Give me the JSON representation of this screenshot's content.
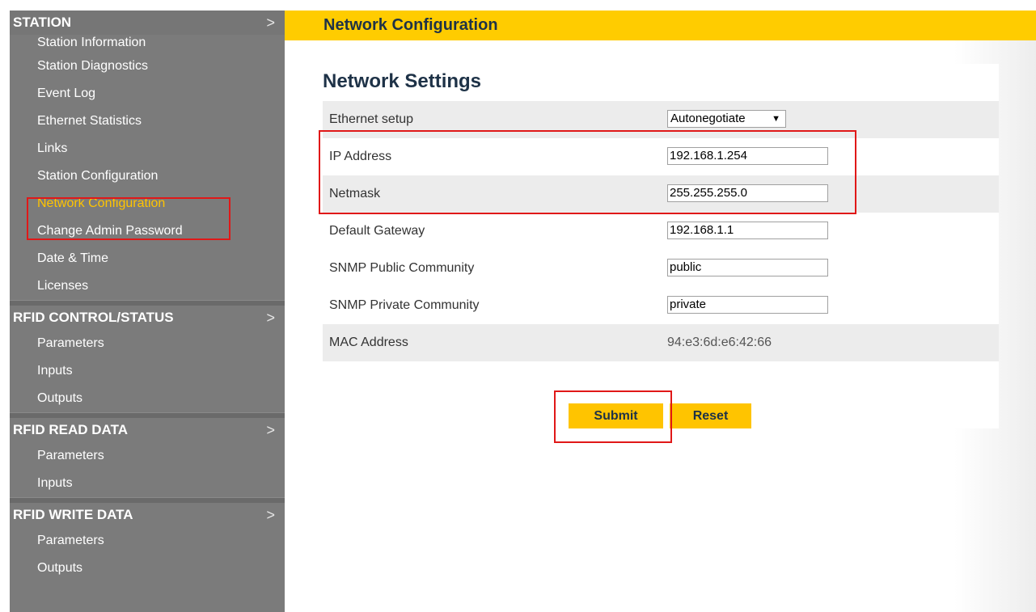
{
  "sidebar": {
    "sections": [
      {
        "title": "STATION",
        "items": [
          "Station Information",
          "Station Diagnostics",
          "Event Log",
          "Ethernet Statistics",
          "Links",
          "Station Configuration",
          "Network Configuration",
          "Change Admin Password",
          "Date & Time",
          "Licenses"
        ]
      },
      {
        "title": "RFID CONTROL/STATUS",
        "items": [
          "Parameters",
          "Inputs",
          "Outputs"
        ]
      },
      {
        "title": "RFID READ DATA",
        "items": [
          "Parameters",
          "Inputs"
        ]
      },
      {
        "title": "RFID WRITE DATA",
        "items": [
          "Parameters",
          "Outputs"
        ]
      }
    ],
    "active_item": "Network Configuration",
    "chevron": ">"
  },
  "header": {
    "title": "Network Configuration"
  },
  "panel": {
    "title": "Network Settings",
    "rows": [
      {
        "label": "Ethernet setup",
        "type": "select",
        "value": "Autonegotiate"
      },
      {
        "label": "IP Address",
        "type": "input",
        "value": "192.168.1.254"
      },
      {
        "label": "Netmask",
        "type": "input",
        "value": "255.255.255.0"
      },
      {
        "label": "Default Gateway",
        "type": "input",
        "value": "192.168.1.1"
      },
      {
        "label": "SNMP Public Community",
        "type": "input",
        "value": "public"
      },
      {
        "label": "SNMP Private Community",
        "type": "input",
        "value": "private"
      },
      {
        "label": "MAC Address",
        "type": "text",
        "value": "94:e3:6d:e6:42:66"
      }
    ]
  },
  "buttons": {
    "submit": "Submit",
    "reset": "Reset"
  },
  "colors": {
    "accent": "#ffcc00",
    "sidebar": "#7b7b7b",
    "highlight": "#e01818",
    "heading": "#1e3247"
  },
  "icons": {
    "select_arrow": "▼"
  }
}
